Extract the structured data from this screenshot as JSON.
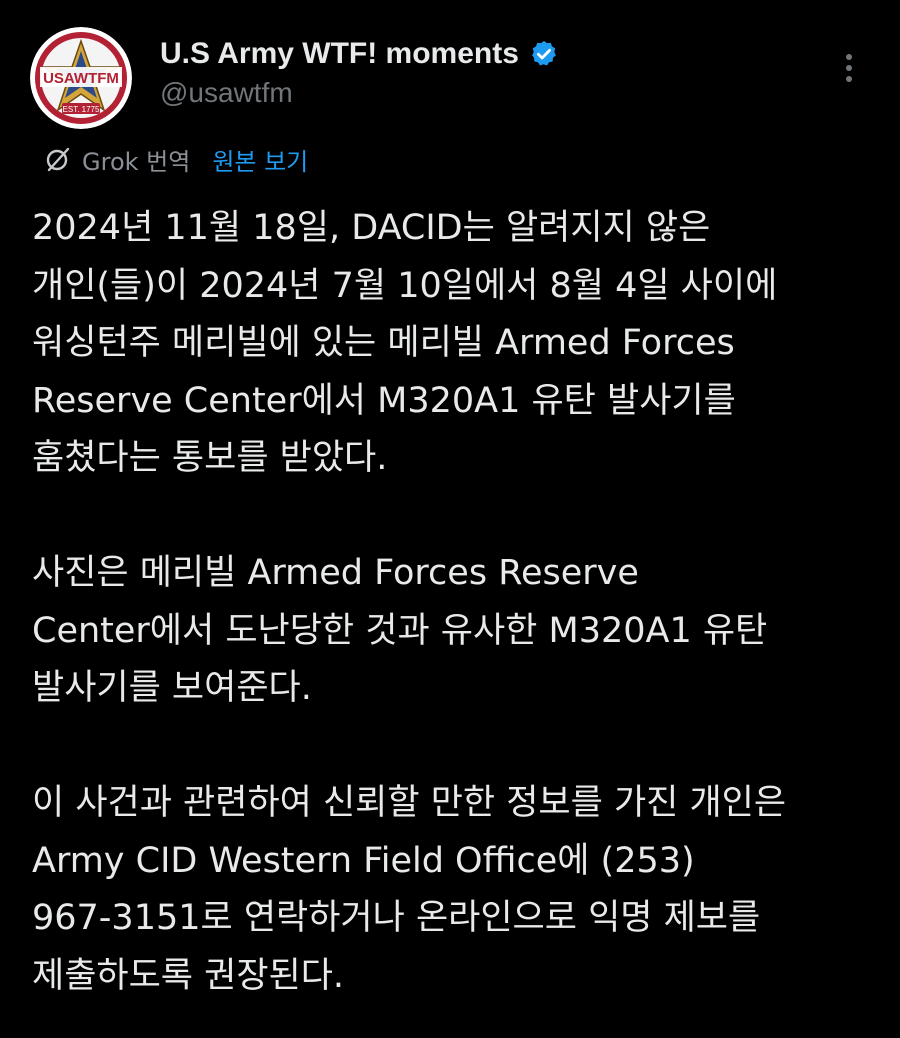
{
  "author": {
    "display_name": "U.S Army WTF! moments",
    "handle": "@usawtfm",
    "verified": true,
    "avatar_icon": "usawtfm-star-logo",
    "avatar_text": "USAWTFM",
    "avatar_est": "EST. 1775"
  },
  "translation": {
    "icon": "grok-icon",
    "label": "Grok 번역",
    "view_original": "원본 보기"
  },
  "tweet": {
    "paragraphs": [
      [
        "2024년 11월 18일, DACID는 알려지지 않은",
        "개인(들)이 2024년 7월 10일에서 8월 4일 사이에",
        "워싱턴주 메리빌에 있는 메리빌 Armed Forces",
        "Reserve Center에서 M320A1 유탄 발사기를",
        "훔쳤다는 통보를 받았다."
      ],
      [
        "사진은 메리빌 Armed Forces Reserve",
        "Center에서 도난당한 것과 유사한 M320A1 유탄",
        "발사기를 보여준다."
      ],
      [
        "이 사건과 관련하여 신뢰할 만한 정보를 가진 개인은",
        "Army CID Western Field Office에 (253)",
        "967-3151로 연락하거나 온라인으로 익명 제보를",
        "제출하도록 권장된다."
      ]
    ]
  },
  "colors": {
    "background": "#000000",
    "text_primary": "#e7e9ea",
    "text_secondary": "#71767b",
    "link": "#1d9bf0",
    "verified": "#1d9bf0"
  }
}
